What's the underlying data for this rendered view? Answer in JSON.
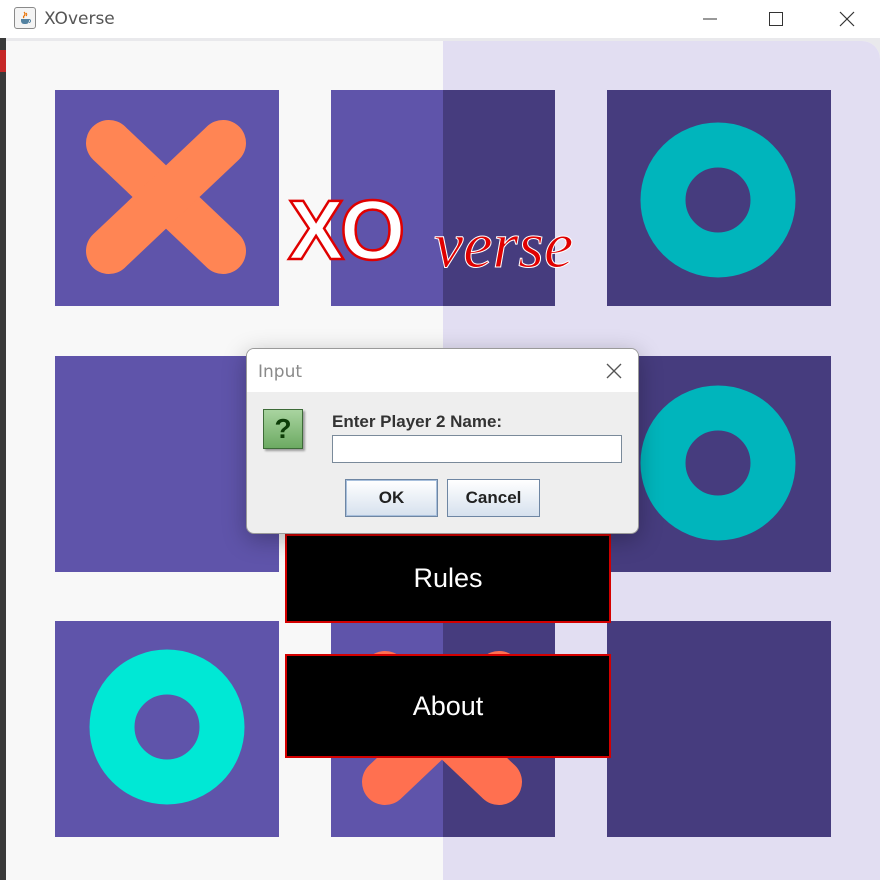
{
  "window": {
    "title": "XOverse",
    "controls": [
      "minimize-icon",
      "maximize-icon",
      "close-icon"
    ]
  },
  "logo": {
    "xo": "XO",
    "verse": "verse",
    "stroke_color": "#e00000"
  },
  "board": {
    "tiles": [
      {
        "row": 1,
        "col": 1,
        "mark": "X",
        "color": "#ff8554"
      },
      {
        "row": 1,
        "col": 2,
        "mark": "",
        "color": ""
      },
      {
        "row": 1,
        "col": 3,
        "mark": "O",
        "color": "#00b5bc"
      },
      {
        "row": 2,
        "col": 1,
        "mark": "",
        "color": ""
      },
      {
        "row": 2,
        "col": 3,
        "mark": "O",
        "color": "#00b5bc"
      },
      {
        "row": 3,
        "col": 1,
        "mark": "O",
        "color": "#00e8d5"
      },
      {
        "row": 3,
        "col": 2,
        "mark": "X",
        "color": "#ff7050"
      },
      {
        "row": 3,
        "col": 3,
        "mark": "",
        "color": ""
      }
    ]
  },
  "menu": {
    "rules_label": "Rules",
    "about_label": "About"
  },
  "dialog": {
    "title": "Input",
    "icon": "question-icon",
    "icon_glyph": "?",
    "prompt": "Enter Player 2 Name:",
    "input_value": "",
    "ok_label": "OK",
    "cancel_label": "Cancel"
  },
  "colors": {
    "tile_light": "#5f54aa",
    "tile_dark": "#463c7e",
    "background_left": "#f8f8f8",
    "background_right": "#e2def2",
    "button_border": "#d40000"
  }
}
